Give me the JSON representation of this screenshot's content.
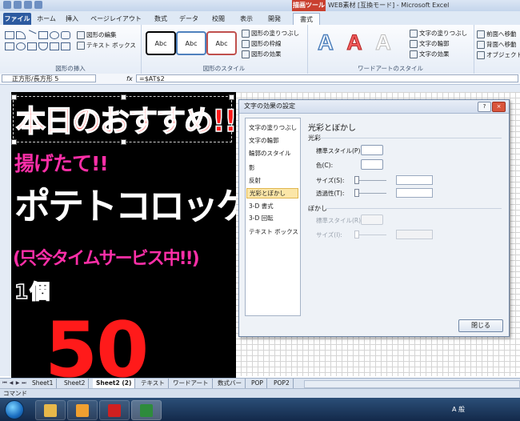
{
  "window": {
    "title": "WEB素材 [互換モード] - Microsoft Excel",
    "context_tab": "描画ツール"
  },
  "ribbon": {
    "tabs": [
      "ファイル",
      "ホーム",
      "挿入",
      "ページレイアウト",
      "数式",
      "データ",
      "校閲",
      "表示",
      "開発",
      "書式"
    ],
    "active_tab": "書式",
    "insert_shapes": {
      "edit_shape": "図形の編集",
      "text_box": "テキスト ボックス",
      "label": "図形の挿入"
    },
    "shape_styles": {
      "samples": [
        "Abc",
        "Abc",
        "Abc"
      ],
      "fill": "図形の塗りつぶし",
      "outline": "図形の枠線",
      "effects": "図形の効果",
      "label": "図形のスタイル"
    },
    "wordart": {
      "letter": "A",
      "text_fill": "文字の塗りつぶし",
      "text_outline": "文字の輪郭",
      "text_effects": "文字の効果",
      "label": "ワードアートのスタイル"
    },
    "arrange": {
      "bring_forward": "前面へ移動",
      "send_backward": "背面へ移動",
      "selection_pane": "オブジェクト"
    }
  },
  "formula_bar": {
    "name_box": "正方形/長方形 5",
    "fx": "fx",
    "formula": "=$AT$2"
  },
  "promo": {
    "line1": "本日のおすすめ!!",
    "line2": "揚げたて!!",
    "line3": "ポテトコロッケ",
    "line4": "(只今タイムサービス中!!)",
    "line5": "1個",
    "line6": "50"
  },
  "dialog": {
    "title": "文字の効果の設定",
    "help": "?",
    "close": "×",
    "categories": [
      "文字の塗りつぶし",
      "文字の輪郭",
      "輪郭のスタイル",
      "影",
      "反射",
      "光彩とぼかし",
      "3-D 書式",
      "3-D 回転",
      "テキスト ボックス"
    ],
    "selected_category": "光彩とぼかし",
    "heading": "光彩とぼかし",
    "glow": {
      "section": "光彩",
      "preset": "標準スタイル(P):",
      "color": "色(C):",
      "size": "サイズ(S):",
      "transparency": "透過性(T):"
    },
    "soft_edges": {
      "section": "ぼかし",
      "preset": "標準スタイル(R):",
      "size": "サイズ(I):"
    },
    "close_button": "閉じる"
  },
  "sheet_tabs": [
    "Sheet1",
    "Sheet2",
    "Sheet2 (2)",
    "テキスト",
    "ワードアート",
    "数式バー",
    "POP",
    "POP2"
  ],
  "active_sheet": "Sheet2 (2)",
  "status_bar": {
    "mode": "コマンド"
  },
  "taskbar": {
    "tray_text": "A 般"
  },
  "colors": {
    "promo_background": "#000000",
    "accent_red": "#ff1a1a",
    "accent_pink": "#ff2fa8",
    "dialog_selected": "#fbe6a8",
    "file_tab": "#2c5aa0",
    "context_tab": "#c9402f"
  },
  "icons": [
    "start-orb-icon",
    "explorer-icon",
    "outlook-icon",
    "app-red-icon",
    "excel-icon"
  ]
}
